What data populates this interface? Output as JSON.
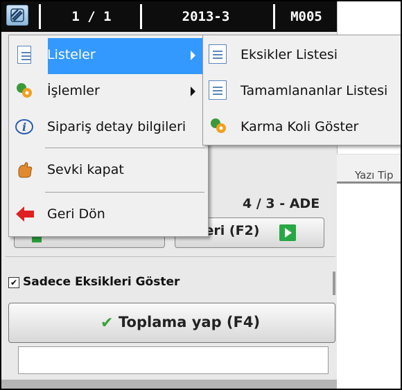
{
  "topbar": {
    "period": "1 / 1",
    "date_code": "2013-3",
    "code": "M005"
  },
  "right_panel": {
    "tab_label": "Yazı Tip"
  },
  "panel": {
    "quantity_text": "4 / 3 - ADE",
    "left_button_label": "",
    "next_button_label": "leri (F2)",
    "checkbox_label": "Sadece Eksikleri Göster",
    "checkbox_checked": true,
    "collect_button_label": "Toplama yap (F4)",
    "input_value": ""
  },
  "menu": {
    "items": [
      {
        "label": "Listeler",
        "icon": "document-icon",
        "has_submenu": true,
        "highlighted": true
      },
      {
        "label": "İşlemler",
        "icon": "gears-icon",
        "has_submenu": true
      },
      {
        "label": "Sipariş detay bilgileri",
        "icon": "info-icon"
      },
      {
        "label": "Sevki kapat",
        "icon": "hand-icon"
      },
      {
        "label": "Geri Dön",
        "icon": "back-arrow-icon"
      }
    ]
  },
  "submenu": {
    "items": [
      {
        "label": "Eksikler Listesi",
        "icon": "document-icon"
      },
      {
        "label": "Tamamlananlar Listesi",
        "icon": "document-icon"
      },
      {
        "label": "Karma Koli Göster",
        "icon": "gears-icon"
      }
    ]
  },
  "colors": {
    "highlight": "#3399ff",
    "topbar_bg": "#0d0d0d",
    "accent_green": "#28a745"
  }
}
